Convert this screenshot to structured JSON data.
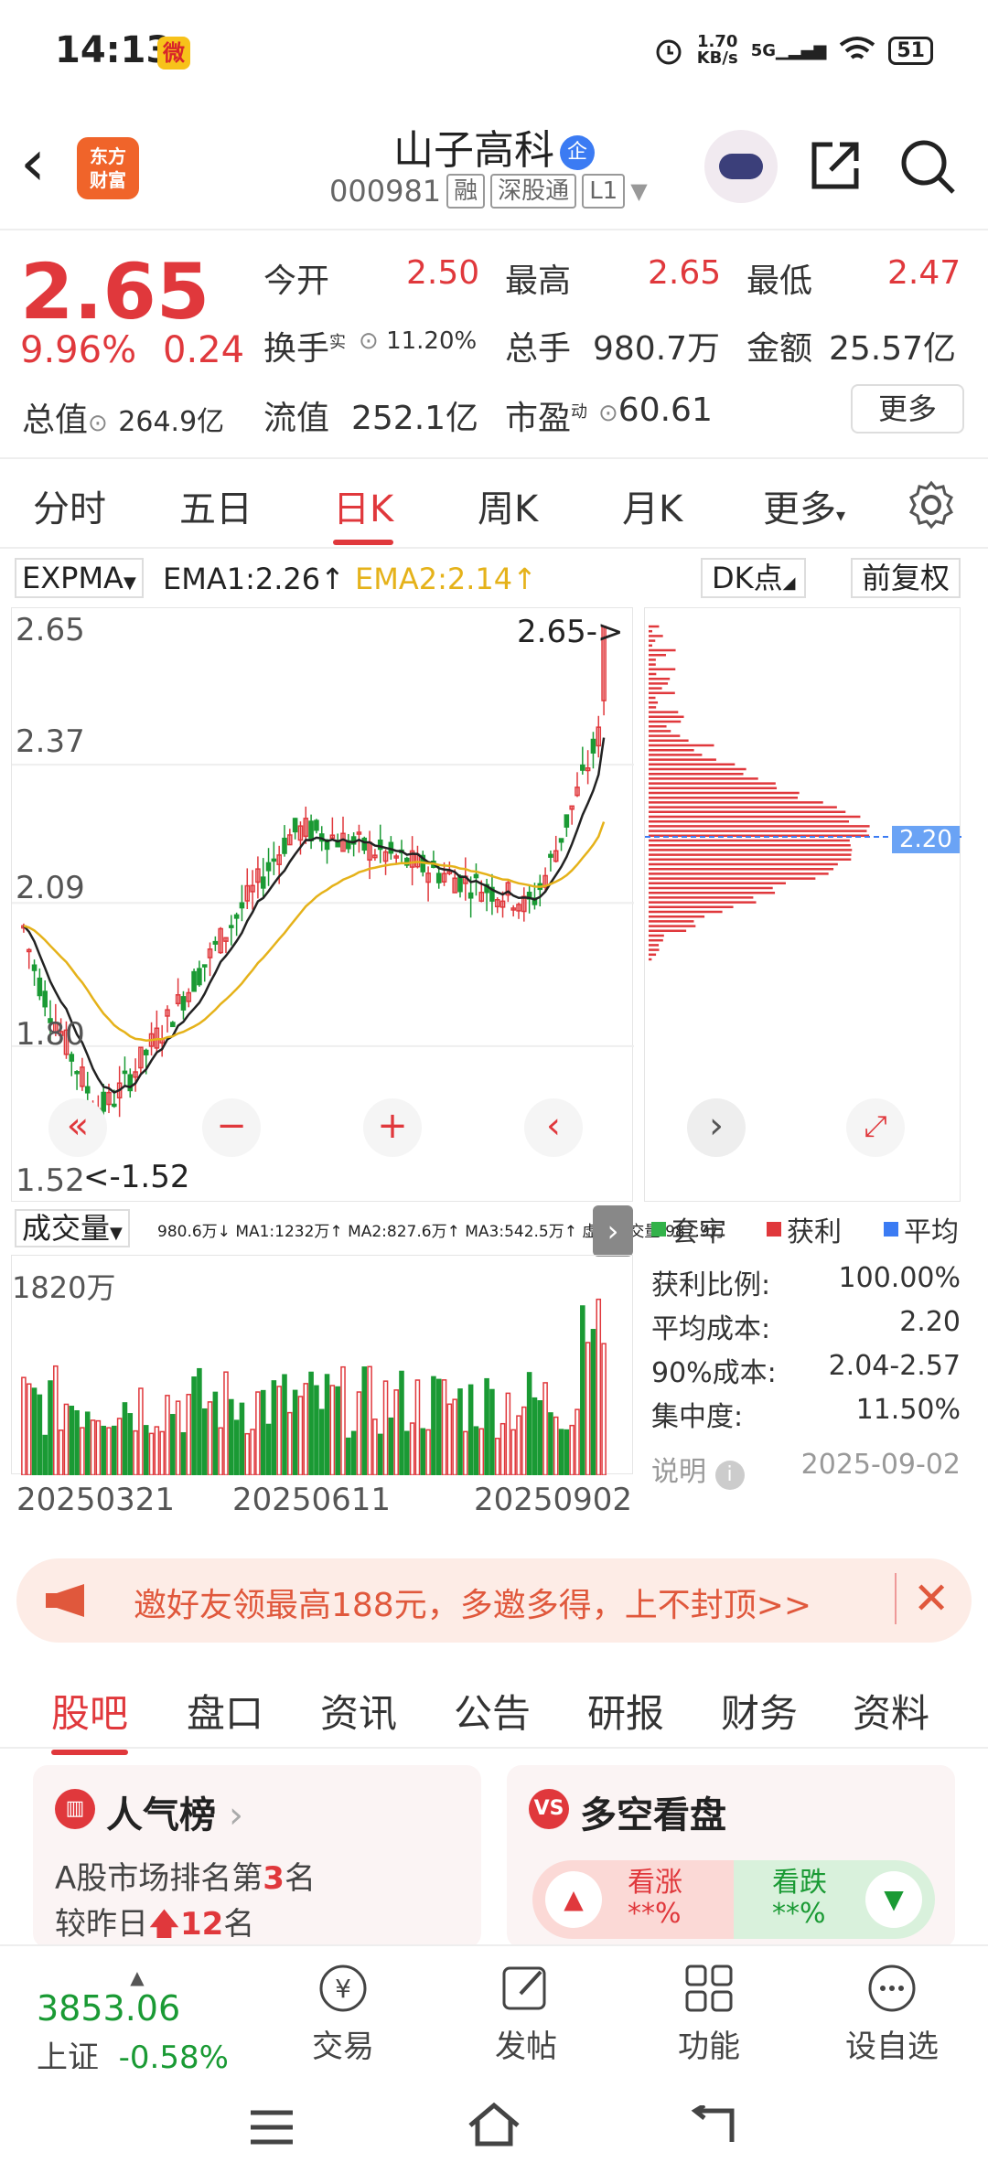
{
  "status_bar": {
    "time": "14:13",
    "net_speed_value": "1.70",
    "net_speed_unit": "KB/s",
    "network": "5G",
    "battery": "51"
  },
  "header": {
    "logo_line1": "东方",
    "logo_line2": "财富",
    "name": "山子高科",
    "badge": "企",
    "code": "000981",
    "tags": [
      "融",
      "深股通",
      "L1"
    ]
  },
  "quote": {
    "price": "2.65",
    "pct": "9.96%",
    "change": "0.24",
    "market_cap_label": "总值",
    "market_cap": "264.9亿",
    "open_label": "今开",
    "open": "2.50",
    "high_label": "最高",
    "high": "2.65",
    "low_label": "最低",
    "low": "2.47",
    "turnover_label": "换手",
    "turnover_sup": "实",
    "turnover": "11.20%",
    "volume_label": "总手",
    "volume": "980.7万",
    "amount_label": "金额",
    "amount": "25.57亿",
    "float_cap_label": "流值",
    "float_cap": "252.1亿",
    "pe_label": "市盈",
    "pe_sup": "动",
    "pe": "60.61",
    "more_label": "更多"
  },
  "periods": [
    {
      "label": "分时",
      "active": false
    },
    {
      "label": "五日",
      "active": false
    },
    {
      "label": "日K",
      "active": true
    },
    {
      "label": "周K",
      "active": false
    },
    {
      "label": "月K",
      "active": false
    },
    {
      "label": "更多",
      "active": false
    }
  ],
  "indicator": {
    "name": "EXPMA",
    "ema1": "EMA1:2.26",
    "ema2": "EMA2:2.14",
    "dk": "DK点",
    "fuquan": "前复权"
  },
  "chart_data": {
    "type": "candlestick",
    "y_ticks": [
      "2.65",
      "2.37",
      "2.09",
      "1.80",
      "1.52"
    ],
    "ylim": [
      1.52,
      2.65
    ],
    "max_marker": "2.65->",
    "min_marker": "<-1.52",
    "avg_cost_line": "2.20",
    "x_ticks": [
      "20250321",
      "20250611",
      "20250902"
    ],
    "volume_max_label": "1820万",
    "volume_legend": "980.6万↓ MA1:1232万↑ MA2:827.6万↑ MA3:542.5万↑ 虚拟成交量:987.9万",
    "colors": {
      "up": "#e0383c",
      "down": "#1a9a34",
      "ema1": "#222222",
      "ema2": "#e5b21a"
    }
  },
  "volume_header": {
    "select": "成交量"
  },
  "chips": {
    "legend": [
      {
        "label": "套牢",
        "color": "#33b24a"
      },
      {
        "label": "获利",
        "color": "#e0383c"
      },
      {
        "label": "平均",
        "color": "#3b7bf3"
      }
    ],
    "stats": [
      {
        "label": "获利比例:",
        "value": "100.00%"
      },
      {
        "label": "平均成本:",
        "value": "2.20"
      },
      {
        "label": "90%成本:",
        "value": "2.04-2.57"
      },
      {
        "label": "集中度:",
        "value": "11.50%"
      }
    ],
    "note_label": "说明",
    "date": "2025-09-02"
  },
  "banner": {
    "text": "邀好友领最高188元，多邀多得，上不封顶>>"
  },
  "bottom_tabs": [
    {
      "label": "股吧",
      "active": true
    },
    {
      "label": "盘口",
      "active": false
    },
    {
      "label": "资讯",
      "active": false
    },
    {
      "label": "公告",
      "active": false
    },
    {
      "label": "研报",
      "active": false
    },
    {
      "label": "财务",
      "active": false
    },
    {
      "label": "资料",
      "active": false
    }
  ],
  "cards": {
    "popularity": {
      "title": "人气榜",
      "line1_prefix": "A股市场排名第",
      "rank": "3",
      "line1_suffix": "名",
      "line2_prefix": "较昨日",
      "change": "12",
      "line2_suffix": "名"
    },
    "sentiment": {
      "title": "多空看盘",
      "bull_label": "看涨",
      "bull_value": "**%",
      "bear_label": "看跌",
      "bear_value": "**%"
    }
  },
  "bottom_nav": {
    "index_value": "3853.06",
    "index_name": "上证",
    "index_change": "-0.58%",
    "items": [
      "交易",
      "发帖",
      "功能",
      "设自选"
    ]
  }
}
